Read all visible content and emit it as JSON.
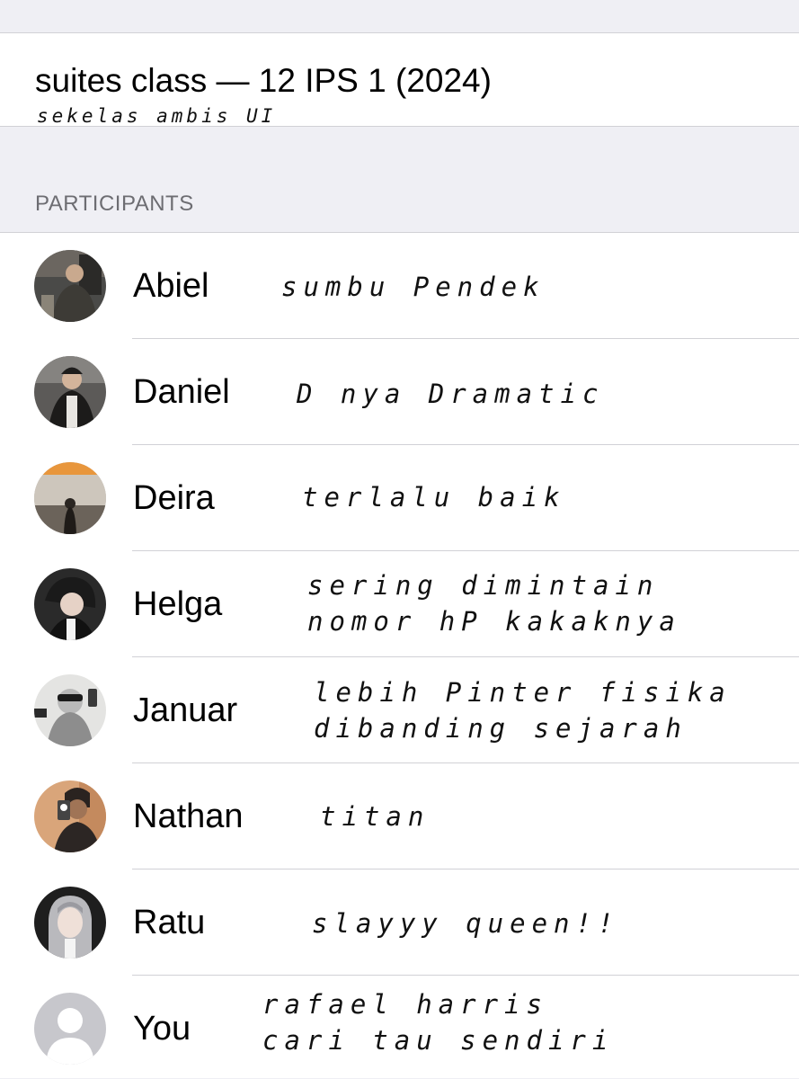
{
  "group": {
    "title": "suites class — 12 IPS 1 (2024)",
    "caption": "sekelas ambis UI"
  },
  "section": {
    "header": "PARTICIPANTS"
  },
  "participants": [
    {
      "name": "Abiel",
      "note1": "sumbu Pendek",
      "note2": ""
    },
    {
      "name": "Daniel",
      "note1": "D nya Dramatic",
      "note2": ""
    },
    {
      "name": "Deira",
      "note1": "terlalu baik",
      "note2": ""
    },
    {
      "name": "Helga",
      "note1": "sering dimintain",
      "note2": "nomor hP kakaknya"
    },
    {
      "name": "Januar",
      "note1": "lebih Pinter fisika",
      "note2": "dibanding sejarah"
    },
    {
      "name": "Nathan",
      "note1": "titan",
      "note2": ""
    },
    {
      "name": "Ratu",
      "note1": "slayyy queen!!",
      "note2": ""
    },
    {
      "name": "You",
      "note1": "rafael harris",
      "note2": "cari tau sendiri"
    }
  ],
  "colors": {
    "background": "#efeff4",
    "card": "#ffffff",
    "separator": "#d1d1d6",
    "section_header": "#6d6d72",
    "default_avatar": "#c7c7cc"
  }
}
